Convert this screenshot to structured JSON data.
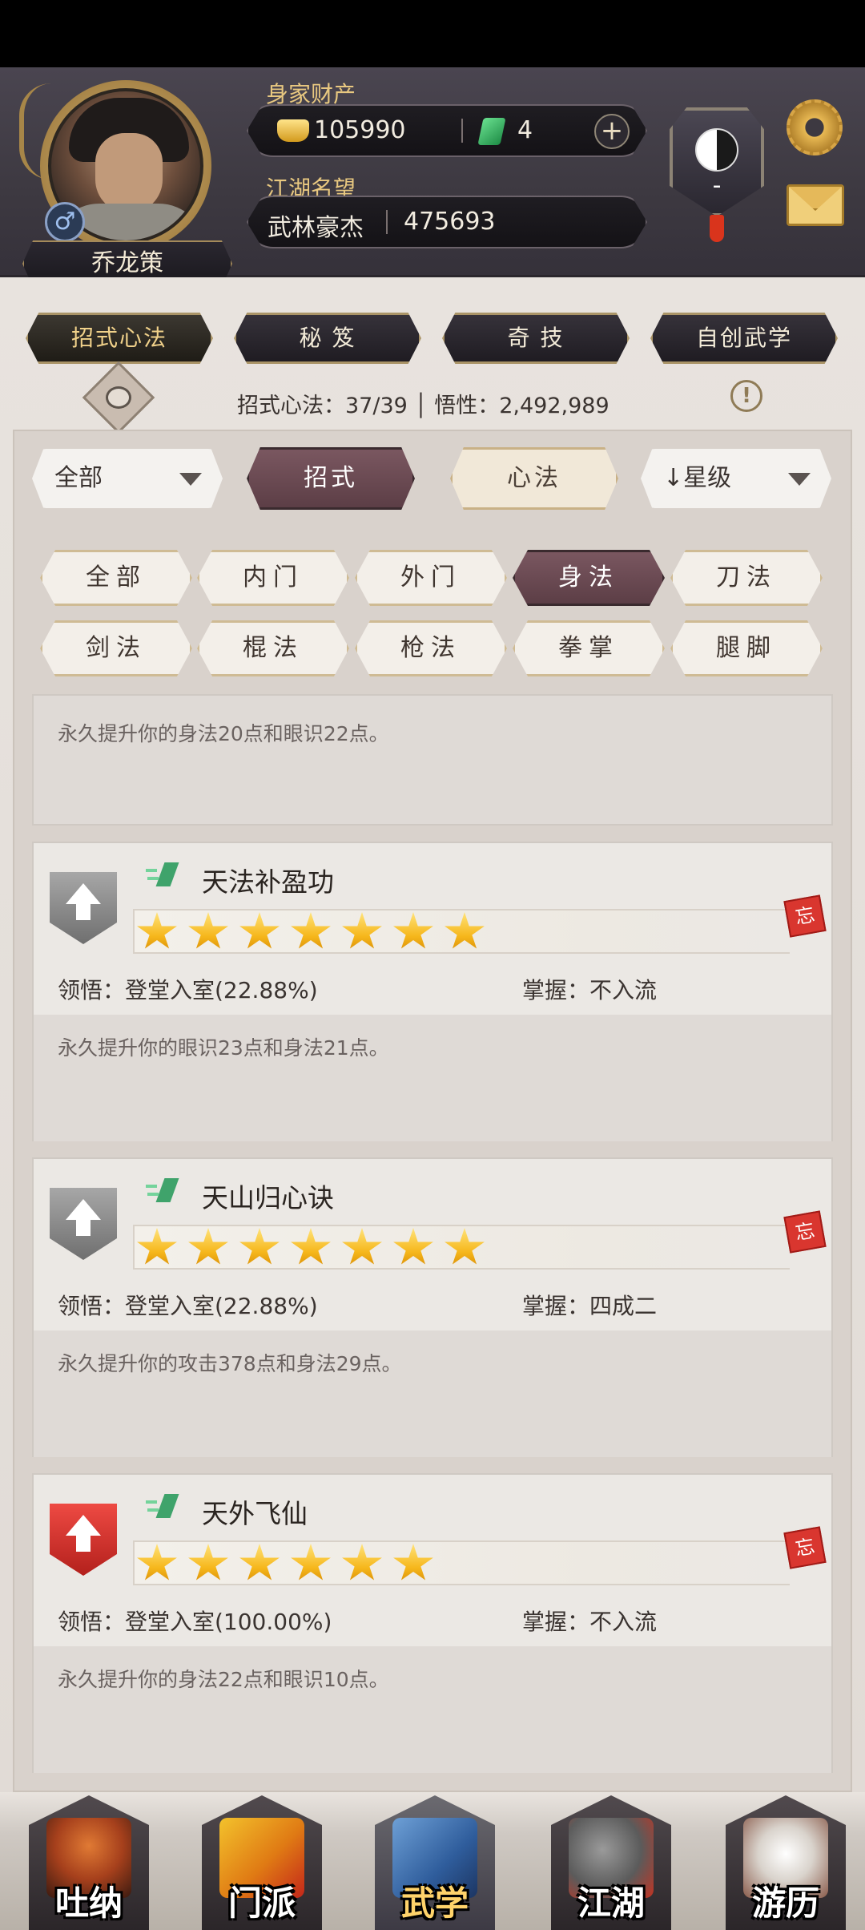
{
  "player": {
    "name": "乔龙策",
    "gender_symbol": "♂",
    "wealth_label": "身家财产",
    "gold": "105990",
    "jade": "4",
    "fame_label": "江湖名望",
    "fame_title": "武林豪杰",
    "fame_value": "475693",
    "rank_dash": "-"
  },
  "top_tabs": [
    "招式心法",
    "秘 笈",
    "奇 技",
    "自创武学"
  ],
  "stats_line": "招式心法：37/39 │ 悟性：2,492,989",
  "filters": {
    "left_dropdown": "全部",
    "seg_moves": "招式",
    "seg_mind": "心法",
    "sort_dropdown": "↓星级",
    "chips": [
      "全部",
      "内门",
      "外门",
      "身法",
      "刀法",
      "剑法",
      "棍法",
      "枪法",
      "拳掌",
      "腿脚"
    ],
    "active_chip": "身法"
  },
  "cards": [
    {
      "name": "",
      "desc": "永久提升你的身法20点和眼识22点。"
    },
    {
      "name": "天法补盈功",
      "stars": 7,
      "comprehension": "领悟：登堂入室(22.88%)",
      "mastery": "掌握：不入流",
      "desc": "永久提升你的眼识23点和身法21点。",
      "seal": "忘",
      "shield": "grey"
    },
    {
      "name": "天山归心诀",
      "stars": 7,
      "comprehension": "领悟：登堂入室(22.88%)",
      "mastery": "掌握：四成二",
      "desc": "永久提升你的攻击378点和身法29点。",
      "seal": "忘",
      "shield": "grey"
    },
    {
      "name": "天外飞仙",
      "stars": 6,
      "comprehension": "领悟：登堂入室(100.00%)",
      "mastery": "掌握：不入流",
      "desc": "永久提升你的身法22点和眼识10点。",
      "seal": "忘",
      "shield": "red"
    }
  ],
  "bottom_nav": [
    "吐纳",
    "门派",
    "武学",
    "江湖",
    "游历"
  ],
  "active_nav": "武学",
  "colors": {
    "accent_active": "#6a4a52",
    "gold_text": "#e8c880",
    "seal_red": "#d9362f"
  }
}
